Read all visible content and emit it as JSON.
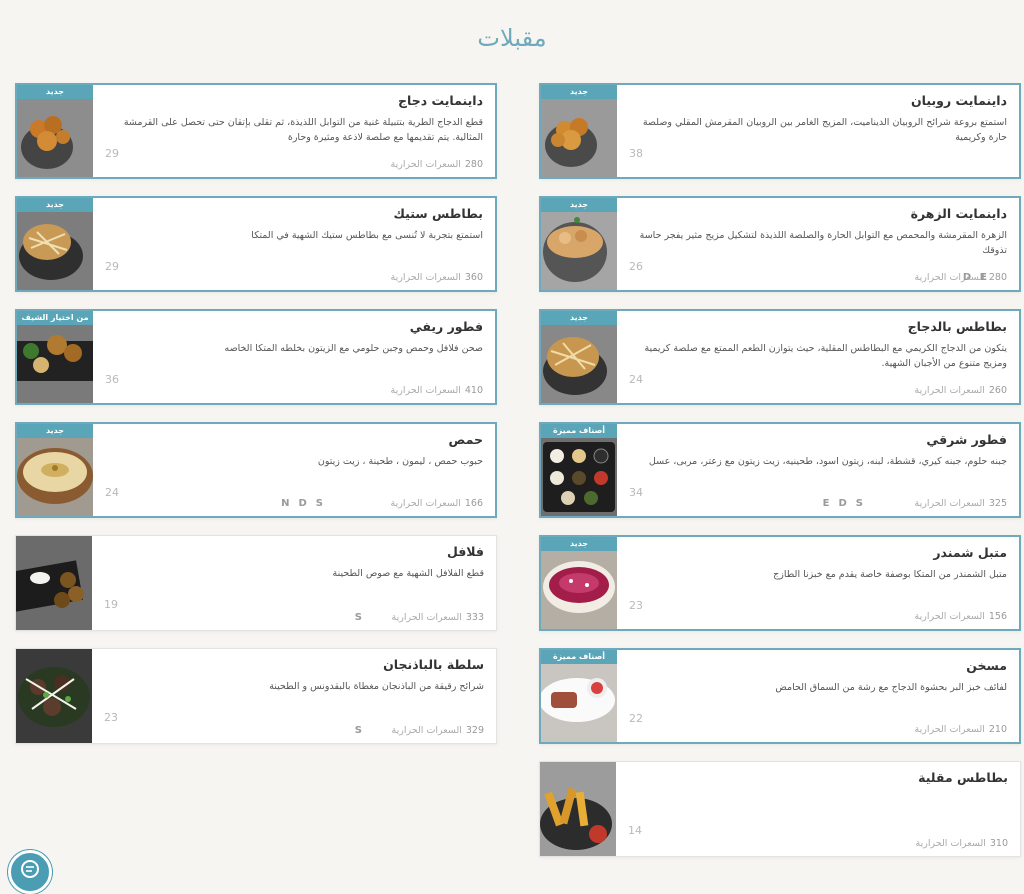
{
  "page": {
    "title": "مقبلات"
  },
  "calorie_label": "السعرات الحرارية",
  "colors": {
    "accent": "#6eaabb",
    "badge": "#5aa6b8",
    "background": "#f7f5f2"
  },
  "cards": [
    {
      "title": "داينمايت روبيان",
      "desc": "استمتع بروعة شرائح الروبيان الديناميت، المزيج الغامر بين الروبيان المقرمش المقلي وصلصة حارة وكريمية",
      "number": "38",
      "calories": "",
      "flags": [],
      "badge": "جديد"
    },
    {
      "title": "داينمايت دجاج",
      "desc": "قطع الدجاج الطرية بتتبيلة غنية من التوابل اللذيذة، ثم تقلى بإتقان حتى تحصل على القرمشة المثالية. يتم تقديمها مع صلصة لاذعة ومثيرة وحارة",
      "number": "29",
      "calories": "280",
      "flags": [],
      "badge": "جديد"
    },
    {
      "title": "داينمايت الزهرة",
      "desc": "الزهرة المقرمشة والمحمص مع التوابل الحارة والصلصة اللذيذة لتشكيل مزيج مثير يفجر حاسة تذوقك",
      "number": "26",
      "calories": "280",
      "flags": [
        "E",
        "D"
      ],
      "badge": "جديد"
    },
    {
      "title": "بطاطس ستيك",
      "desc": "استمتع بتجربة لا تُنسى مع بطاطس ستيك الشهية في المتكا",
      "number": "29",
      "calories": "360",
      "flags": [],
      "badge": "جديد"
    },
    {
      "title": "بطاطس بالدجاج",
      "desc": "يتكون من الدجاج الكريمي مع البطاطس المقلية، حيث يتوازن الطعم الممتع مع صلصة كريمية ومزيج متنوع من الأجبان الشهية.",
      "number": "24",
      "calories": "260",
      "flags": [],
      "badge": "جديد"
    },
    {
      "title": "فطور ريفي",
      "desc": "صحن فلافل وحمص وجبن حلومي مع الزيتون بخلطه المتكا الخاصه",
      "number": "36",
      "calories": "410",
      "flags": [],
      "badge": "من اختيار الشيف"
    },
    {
      "title": "فطور شرقي",
      "desc": "جبنه حلوم، جبنه كيري، قشطة، لبنه، زيتون اسود، طحينيه، زيت زيتون مع زعتر، مربى، عسل",
      "number": "34",
      "calories": "325",
      "flags": [
        "E",
        "D",
        "S"
      ],
      "badge": "أصناف مميزة"
    },
    {
      "title": "حمص",
      "desc": "حبوب حمص ، ليمون ، طحينة ، زيت زيتون",
      "number": "24",
      "calories": "166",
      "flags": [
        "N",
        "D",
        "S"
      ],
      "badge": "جديد"
    },
    {
      "title": "متبل شمندر",
      "desc": "متبل الشمندر من المتكا بوصفة خاصة يقدم مع خبزنا الطازج",
      "number": "23",
      "calories": "156",
      "flags": [],
      "badge": "جديد"
    },
    {
      "title": "فلافل",
      "desc": "قطع الفلافل الشهية مع صوص الطحينة",
      "number": "19",
      "calories": "333",
      "flags": [
        "S"
      ],
      "badge": ""
    },
    {
      "title": "مسخن",
      "desc": "لفائف خبز البر بحشوة الدجاج مع رشة من السماق الحامض",
      "number": "22",
      "calories": "210",
      "flags": [],
      "badge": "أصناف مميزة"
    },
    {
      "title": "سلطة بالباذنجان",
      "desc": "شرائح رقيقة من الباذنجان مغطاة بالبقدونس و الطحينة",
      "number": "23",
      "calories": "329",
      "flags": [
        "S"
      ],
      "badge": ""
    },
    {
      "title": "بطاطس مقلية",
      "desc": "",
      "number": "14",
      "calories": "310",
      "flags": [],
      "badge": ""
    }
  ]
}
